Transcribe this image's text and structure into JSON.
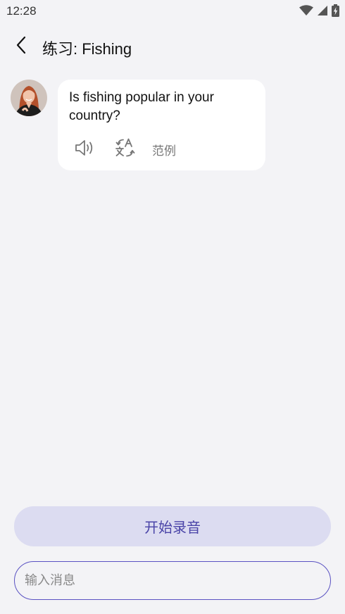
{
  "status_bar": {
    "time": "12:28",
    "icons": [
      "wifi-icon",
      "cellular-signal-icon",
      "battery-charging-icon"
    ]
  },
  "header": {
    "back_icon": "chevron-left-icon",
    "title": "练习: Fishing"
  },
  "message": {
    "avatar": "tutor-avatar",
    "text": "Is fishing popular in your country?",
    "actions": {
      "speaker_icon": "speaker-icon",
      "translate_icon": "translate-icon",
      "example_label": "范例"
    }
  },
  "controls": {
    "record_label": "开始录音",
    "input_value": "",
    "input_placeholder": "输入消息"
  },
  "colors": {
    "background": "#f3f3f6",
    "accent": "#5a52c2",
    "record_button_bg": "#dcdcf1",
    "record_button_text": "#4a44a8"
  }
}
